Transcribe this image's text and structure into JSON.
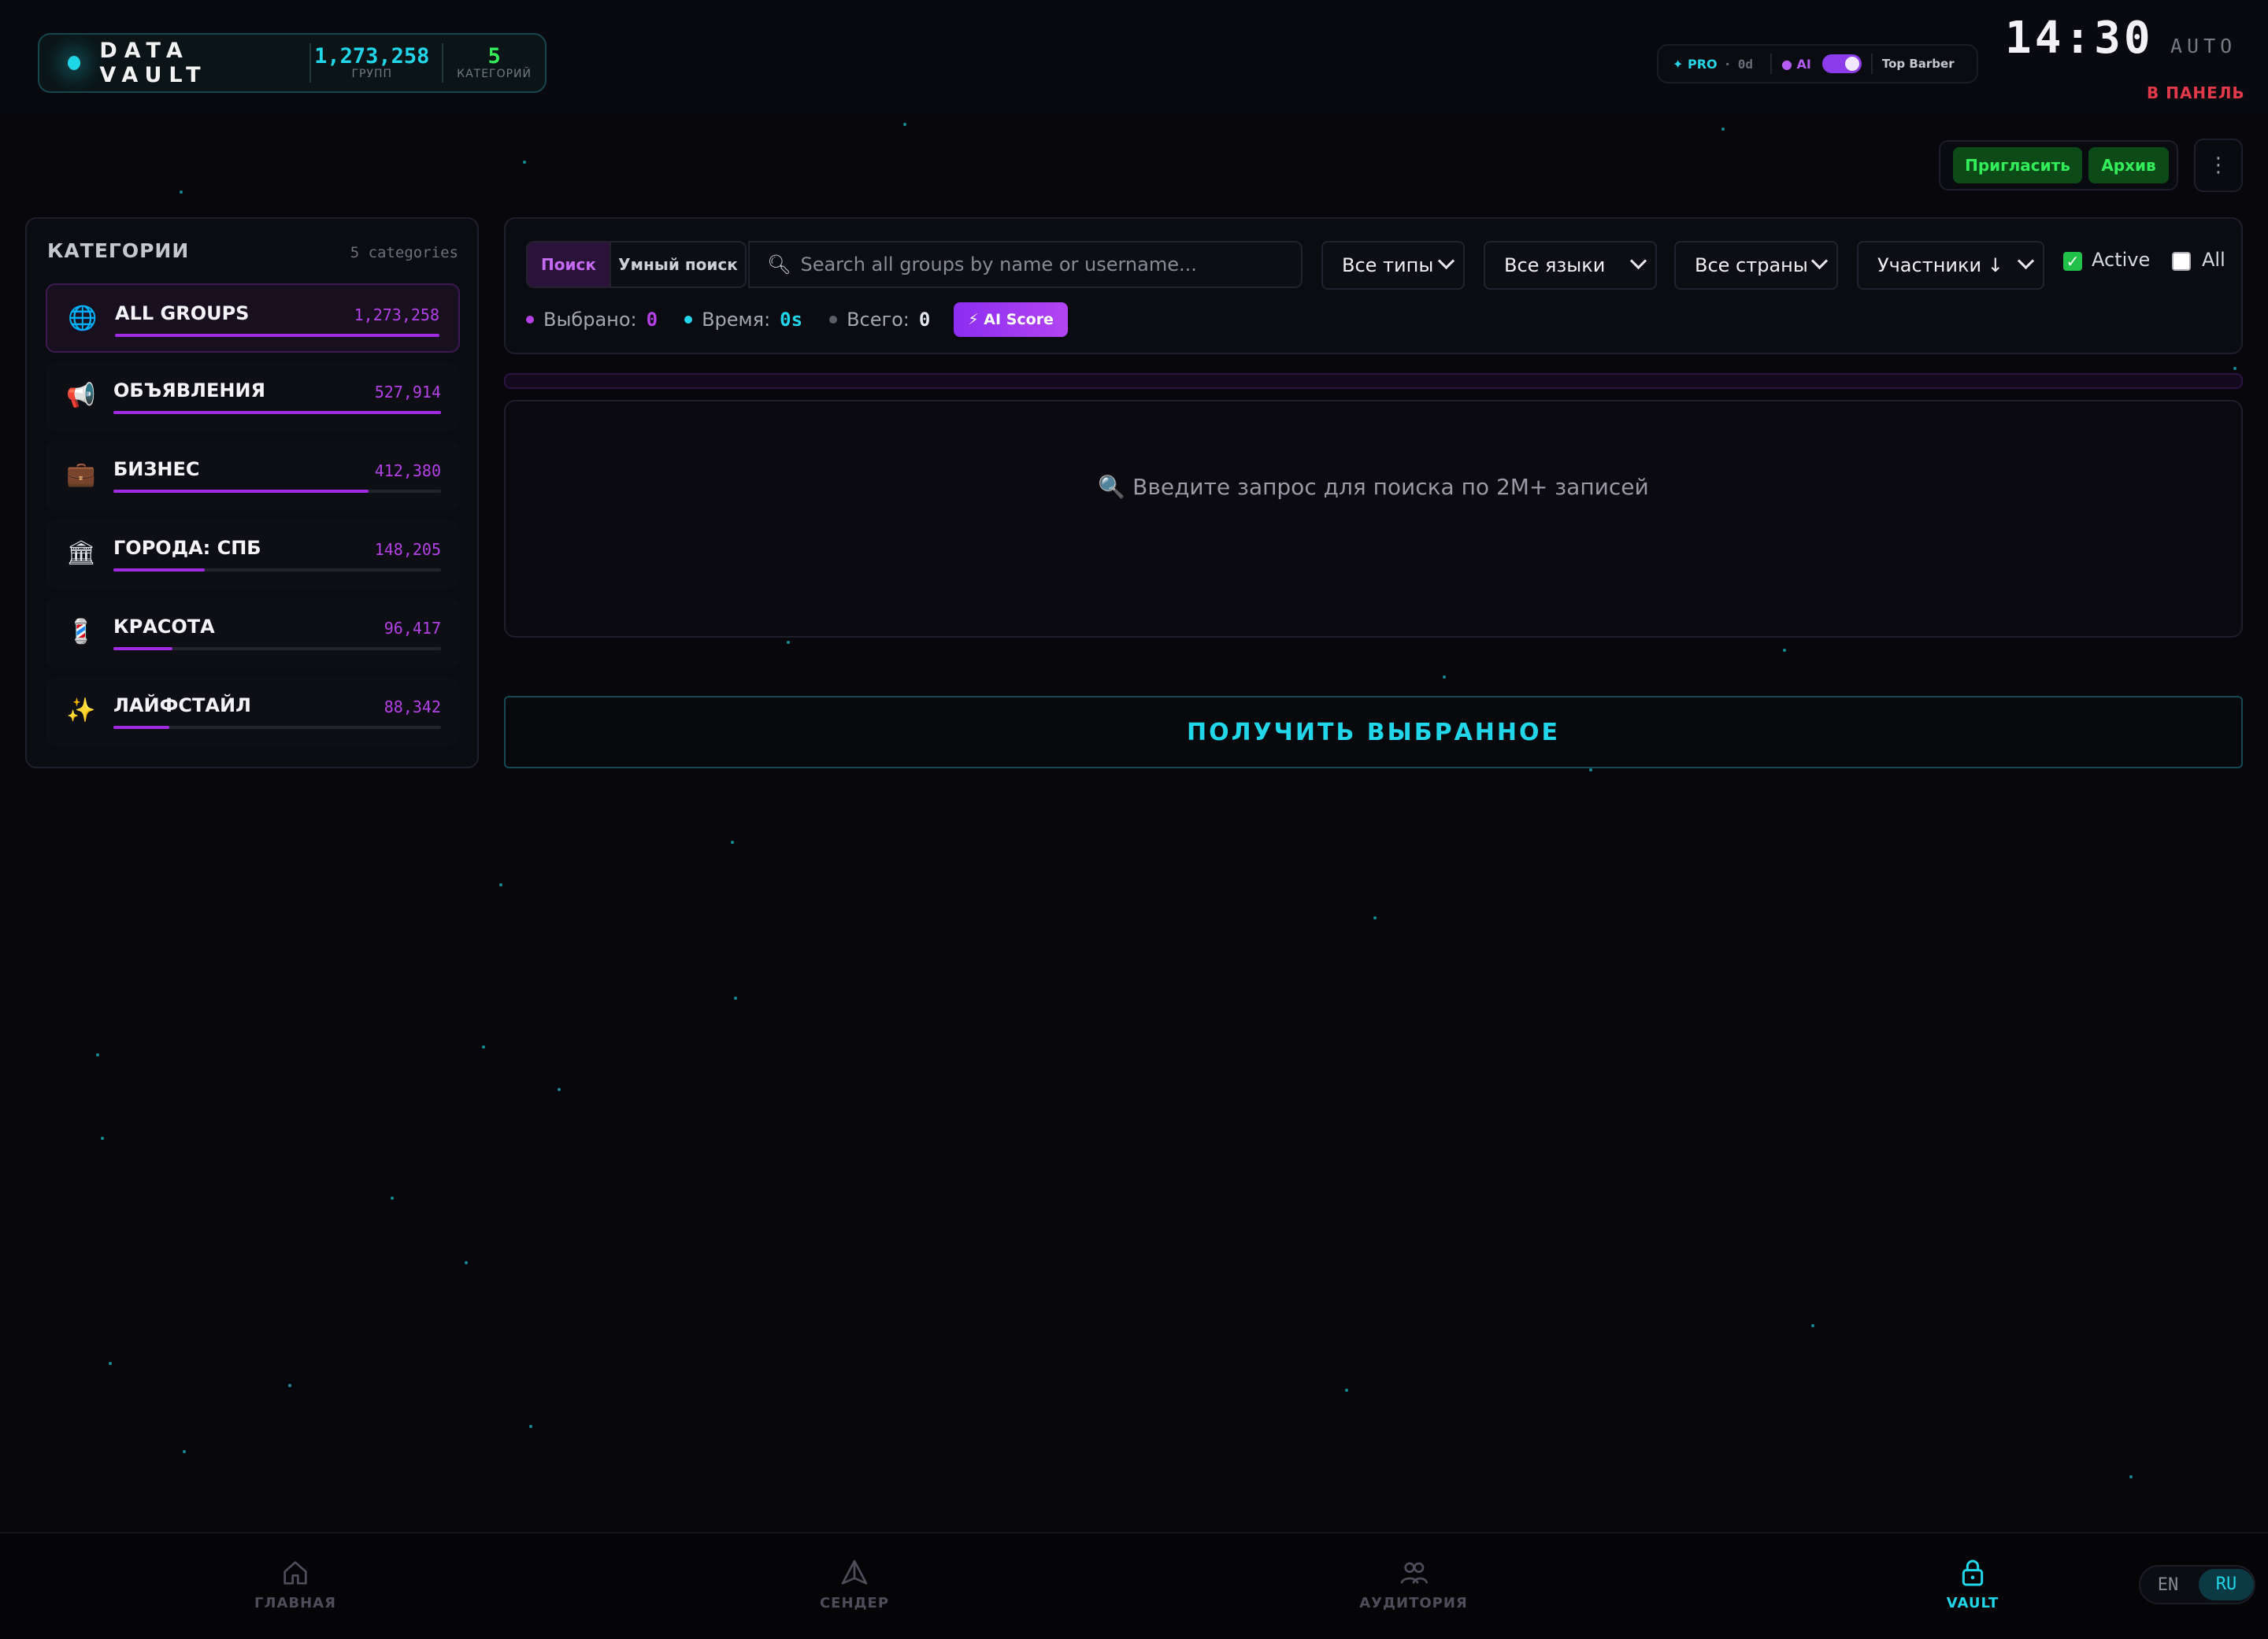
{
  "colors": {
    "background": "#07070c",
    "accent_cyan": "#22d6ea",
    "accent_purple": "#a02be3",
    "accent_green": "#33ee5a",
    "alert_red": "#e23a4a"
  },
  "header": {
    "brand_title": "DATA VAULT",
    "groups_count": "1,273,258",
    "groups_label": "ГРУПП",
    "categories_count": "5",
    "categories_label": "КАТЕГОРИЙ",
    "status": {
      "plan": "✦ PRO",
      "days": "0d",
      "ai_label": "● AI",
      "ai_enabled": true,
      "user": "Top Barber"
    },
    "clock": "14:30",
    "mode": "AUTO",
    "to_panel": "В ПАНЕЛЬ"
  },
  "actions": {
    "invite_label": "Пригласить",
    "archive_label": "Архив",
    "more_label": "⋮"
  },
  "categories": {
    "title": "КАТЕГОРИИ",
    "count_label": "5 categories",
    "items": [
      {
        "icon": "🌐",
        "icon_name": "globe-icon",
        "label": "ALL GROUPS",
        "count": "1,273,258",
        "share": 1.0,
        "active": true
      },
      {
        "icon": "📢",
        "icon_name": "megaphone-icon",
        "label": "ОБЪЯВЛЕНИЯ",
        "count": "527,914",
        "share": 1.0,
        "active": false
      },
      {
        "icon": "💼",
        "icon_name": "briefcase-icon",
        "label": "БИЗНЕС",
        "count": "412,380",
        "share": 0.78,
        "active": false
      },
      {
        "icon": "🏛",
        "icon_name": "classical-building-icon",
        "label": "ГОРОДА: СПБ",
        "count": "148,205",
        "share": 0.28,
        "active": false
      },
      {
        "icon": "💈",
        "icon_name": "barber-pole-icon",
        "label": "КРАСОТА",
        "count": "96,417",
        "share": 0.18,
        "active": false
      },
      {
        "icon": "✨",
        "icon_name": "sparkles-icon",
        "label": "ЛАЙФСТАЙЛ",
        "count": "88,342",
        "share": 0.17,
        "active": false
      }
    ]
  },
  "search": {
    "mode_search": "Поиск",
    "mode_smart": "Умный поиск",
    "placeholder": "Search all groups by name or username...",
    "filters": {
      "types": "Все типы",
      "languages": "Все языки",
      "countries": "Все страны",
      "sort": "Участники ↓"
    },
    "active_label": "Active",
    "active_checked": true,
    "all_label": "All",
    "all_checked": false
  },
  "stats": {
    "selected_label": "Выбрано:",
    "selected_value": "0",
    "time_label": "Время:",
    "time_value": "0s",
    "total_label": "Всего:",
    "total_value": "0",
    "ai_score_label": "⚡ AI Score"
  },
  "results": {
    "empty_icon": "🔍",
    "empty_text": "Введите запрос для поиска по 2M+ записей"
  },
  "get_selected_label": "ПОЛУЧИТЬ ВЫБРАННОЕ",
  "bottom_nav": [
    {
      "label": "ГЛАВНАЯ",
      "icon_name": "home-icon",
      "active": false
    },
    {
      "label": "СЕНДЕР",
      "icon_name": "send-icon",
      "active": false
    },
    {
      "label": "АУДИТОРИЯ",
      "icon_name": "audience-icon",
      "active": false
    },
    {
      "label": "VAULT",
      "icon_name": "lock-icon",
      "active": true
    }
  ],
  "language": {
    "en": "EN",
    "ru": "RU",
    "selected": "RU"
  }
}
